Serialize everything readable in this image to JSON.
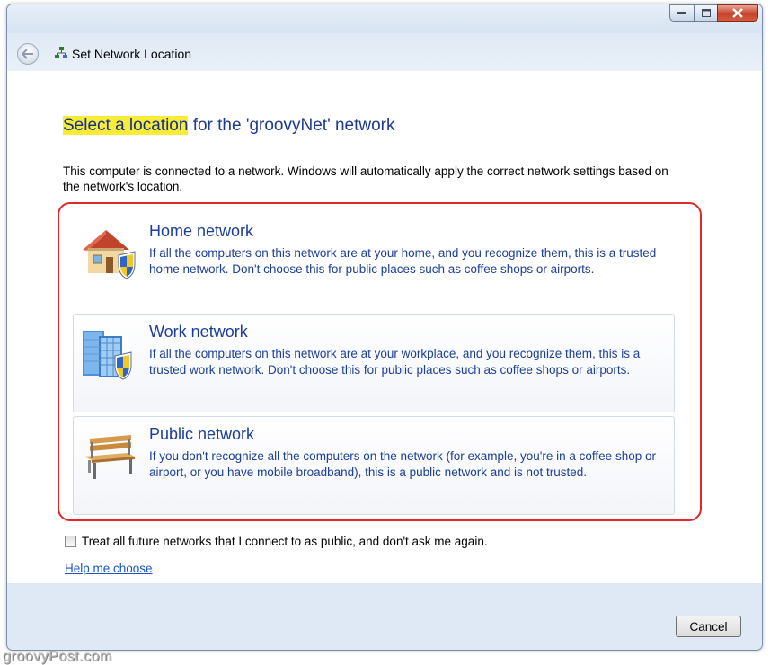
{
  "window": {
    "nav_title": "Set Network Location",
    "caption_icons": [
      "minimize-icon",
      "maximize-icon",
      "close-icon"
    ]
  },
  "heading": {
    "highlight": "Select a location",
    "rest": " for the 'groovyNet' network"
  },
  "description": "This computer is connected to a network. Windows will automatically apply the correct network settings based on the network's location.",
  "options": [
    {
      "title": "Home network",
      "text": "If all the computers on this network are at your home, and you recognize them, this is a trusted home network.  Don't choose this for public places such as coffee shops or airports.",
      "icon": "house-shield-icon"
    },
    {
      "title": "Work network",
      "text": "If all the computers on this network are at your workplace, and you recognize them, this is a trusted work network.  Don't choose this for public places such as coffee shops or airports.",
      "icon": "office-building-shield-icon"
    },
    {
      "title": "Public network",
      "text": "If you don't recognize all the computers on the network (for example, you're in a coffee shop or airport, or you have mobile broadband), this is a public network and is not trusted.",
      "icon": "park-bench-icon"
    }
  ],
  "checkbox": {
    "label": "Treat all future networks that I connect to as public, and don't ask me again.",
    "checked": false
  },
  "help_link": "Help me choose",
  "cancel_button": "Cancel",
  "watermark": "groovyPost.com",
  "colors": {
    "highlight": "#f9ec38",
    "heading_text": "#1e3a8e",
    "option_text": "#1b3e9c",
    "annotation_frame": "#e3262b",
    "link": "#1a56c8"
  }
}
